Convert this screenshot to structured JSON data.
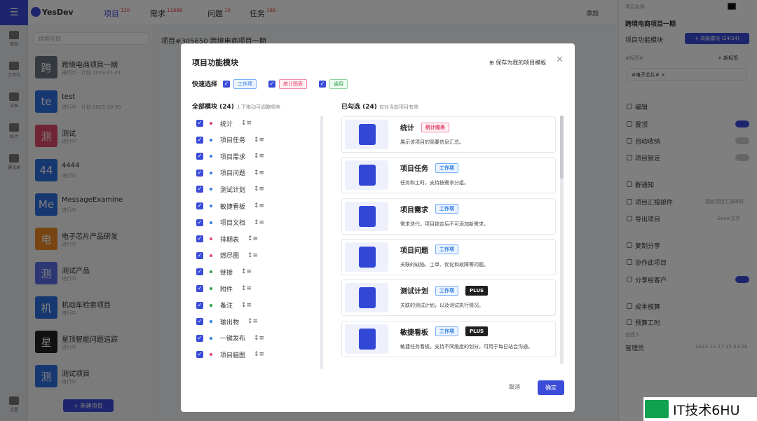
{
  "app": {
    "brand": "YesDev",
    "nav": [
      {
        "label": "项目",
        "badge": "120"
      },
      {
        "label": "需求",
        "badge": "11888"
      },
      {
        "label": "问题",
        "badge": "19"
      },
      {
        "label": "任务",
        "badge": "168"
      }
    ],
    "add_label": "添加"
  },
  "rail": {
    "items": [
      "项目",
      "工作台",
      "文档",
      "统计",
      "通讯录"
    ],
    "bottom": "设置"
  },
  "list": {
    "search_placeholder": "搜索项目",
    "projects": [
      {
        "avatar": "跨",
        "name": "跨境电商项目一期",
        "sub": "进行中 · 计划 2023-11-21",
        "color": "#6b7280"
      },
      {
        "avatar": "te",
        "name": "test",
        "sub": "进行中 · 计划 2023-10-30",
        "color": "#2f6fe0"
      },
      {
        "avatar": "测",
        "name": "测试",
        "sub": "进行中",
        "color": "#e04a6a"
      },
      {
        "avatar": "44",
        "name": "4444",
        "sub": "进行中",
        "color": "#2f6fe0"
      },
      {
        "avatar": "Me",
        "name": "MessageExamine",
        "sub": "进行中",
        "color": "#2f6fe0"
      },
      {
        "avatar": "电",
        "name": "电子芯片产品研发",
        "sub": "进行中",
        "color": "#f08a24"
      },
      {
        "avatar": "测",
        "name": "测试产品",
        "sub": "进行中",
        "color": "#5b6ee8"
      },
      {
        "avatar": "机",
        "name": "机动车检索项目",
        "sub": "进行中",
        "color": "#2f6fe0"
      },
      {
        "avatar": "星",
        "name": "星顶智能问题追踪",
        "sub": "进行中",
        "color": "#222"
      },
      {
        "avatar": "测",
        "name": "测试项目",
        "sub": "进行中",
        "color": "#2f6fe0"
      }
    ],
    "new_button": "+ 新建项目"
  },
  "main": {
    "header": "项目#305650 跨境电商项目一期"
  },
  "right": {
    "project_name_label": "项目名称",
    "project_name": "跨境电商项目一期",
    "module_label": "项目功能模块",
    "module_button": "+ 高级模块 (24/24)",
    "tag_label": "#标签#",
    "tag_add": "+ 新标签",
    "tag_value": "#电子芯片# ×",
    "items": [
      "编辑",
      "置顶",
      "自动收纳",
      "项目锁定",
      "群通知",
      "项目汇报邮件",
      "导出项目",
      "复制分享",
      "协作此项目",
      "分享给客户",
      "成本核算",
      "预算工时"
    ],
    "creator_label": "创建人",
    "creator": "管理员",
    "created_at": "2023-11-17 15:33:26",
    "report_hint": "接收项目汇报邮件",
    "export_hint": "Excel文件"
  },
  "modal": {
    "title": "项目功能模块",
    "save_link": "保存为我的项目模板",
    "quick_label": "快速选择",
    "quick_tags": [
      {
        "label": "工作项",
        "kind": "work"
      },
      {
        "label": "统计图表",
        "kind": "stat"
      },
      {
        "label": "通用",
        "kind": "gen"
      }
    ],
    "all_title": "全部模块 (24)",
    "all_hint": "上下拖动可调整顺序",
    "modules": [
      {
        "name": "统计",
        "color": "#e0456b"
      },
      {
        "name": "项目任务",
        "color": "#2f7de1"
      },
      {
        "name": "项目需求",
        "color": "#2f7de1"
      },
      {
        "name": "项目问题",
        "color": "#2f7de1"
      },
      {
        "name": "测试计划",
        "color": "#2f7de1"
      },
      {
        "name": "敏捷看板",
        "color": "#2f7de1"
      },
      {
        "name": "项目文档",
        "color": "#2f7de1"
      },
      {
        "name": "排期表",
        "color": "#e0456b"
      },
      {
        "name": "燃尽图",
        "color": "#e0456b"
      },
      {
        "name": "链接",
        "color": "#2f9e44"
      },
      {
        "name": "附件",
        "color": "#2f9e44"
      },
      {
        "name": "备注",
        "color": "#2f9e44"
      },
      {
        "name": "输出物",
        "color": "#2f7de1"
      },
      {
        "name": "一键发布",
        "color": "#2f7de1"
      },
      {
        "name": "项目脑图",
        "color": "#e0456b"
      }
    ],
    "selected_title": "已勾选 (24)",
    "selected_hint": "仅对当前项目有效",
    "cards": [
      {
        "title": "统计",
        "tag": "统计图表",
        "kind": "stat",
        "plus": "",
        "desc": "展示该项目的简要信息汇总。"
      },
      {
        "title": "项目任务",
        "tag": "工作项",
        "kind": "work",
        "plus": "",
        "desc": "任务和工时，支持按需求分组。"
      },
      {
        "title": "项目需求",
        "tag": "工作项",
        "kind": "work",
        "plus": "",
        "desc": "需求迭代，项目锁定后不可添加新需求。"
      },
      {
        "title": "项目问题",
        "tag": "工作项",
        "kind": "work",
        "plus": "",
        "desc": "关联的缺陷、工单、优化和故障等问题。"
      },
      {
        "title": "测试计划",
        "tag": "工作项",
        "kind": "work",
        "plus": "PLUS",
        "desc": "关联的测试计划，以及测试执行情况。"
      },
      {
        "title": "敏捷看板",
        "tag": "工作项",
        "kind": "work",
        "plus": "PLUS",
        "desc": "敏捷任务看板。支持不同维度的划分，可用于每日站会沟通。"
      }
    ],
    "cancel": "取消",
    "ok": "确定"
  },
  "watermark": "IT技术6HU"
}
